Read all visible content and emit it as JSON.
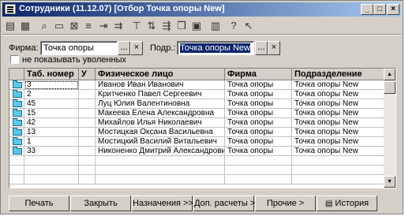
{
  "window": {
    "title": "Сотрудники (11.12.07) [Отбор Точка опоры New]"
  },
  "toolbar": {
    "icons": [
      "new-icon",
      "open-icon",
      "find-icon",
      "edit-icon",
      "delete-icon",
      "filter-icon",
      "move-icon",
      "copy-icon",
      "tree-icon",
      "paste-icon",
      "print-icon",
      "table-icon",
      "help-icon",
      "cursor-help-icon"
    ]
  },
  "filters": {
    "firm_label": "Фирма:",
    "firm_value": "Точка опоры",
    "dept_label": "Подр.:",
    "dept_value": "Точка опоры New",
    "browse_glyph": "...",
    "clear_glyph": "×",
    "hide_fired_label": "не показывать уволенных"
  },
  "table": {
    "columns": [
      "Таб. номер",
      "У",
      "Физическое лицо",
      "Фирма",
      "Подразделение"
    ],
    "rows": [
      {
        "num": "3",
        "u": "",
        "name": "Иванов Иван Иванович",
        "firm": "Точка опоры",
        "dept": "Точка опоры New"
      },
      {
        "num": "2",
        "u": "",
        "name": "Критченко Павел Сергеевич",
        "firm": "Точка опоры",
        "dept": "Точка опоры New"
      },
      {
        "num": "45",
        "u": "",
        "name": "Луц Юлия Валентиновна",
        "firm": "Точка опоры",
        "dept": "Точка опоры New"
      },
      {
        "num": "15",
        "u": "",
        "name": "Макеева Елена Александровна",
        "firm": "Точка опоры",
        "dept": "Точка опоры New"
      },
      {
        "num": "42",
        "u": "",
        "name": "Михайлов Илья Николаевич",
        "firm": "Точка опоры",
        "dept": "Точка опоры New"
      },
      {
        "num": "13",
        "u": "",
        "name": "Мостицкая Оксана Васильевна",
        "firm": "Точка опоры",
        "dept": "Точка опоры New"
      },
      {
        "num": "1",
        "u": "",
        "name": "Мостицкий Василий Витальевич",
        "firm": "Точка опоры",
        "dept": "Точка опоры New"
      },
      {
        "num": "33",
        "u": "",
        "name": "Никоненко Дмитрий Александрович",
        "firm": "Точка опоры",
        "dept": "Точка опоры New"
      }
    ]
  },
  "buttons": {
    "print": "Печать",
    "close": "Закрыть",
    "assignments": "Назначения >>",
    "extra_calc": "Доп. расчеты >>",
    "other": "Прочие >",
    "history": "История"
  }
}
